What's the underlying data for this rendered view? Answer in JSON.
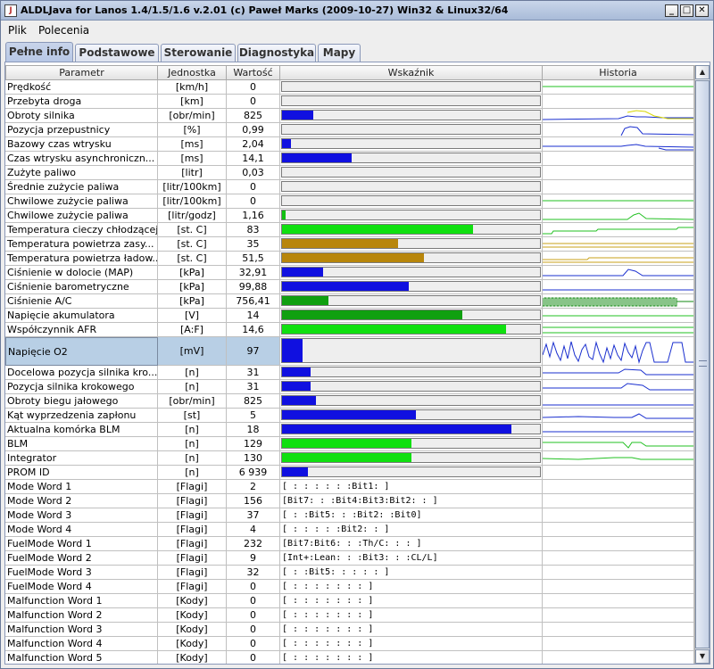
{
  "window": {
    "title": "ALDLJava for Lanos 1.4/1.5/1.6 v.2.01  (c) Paweł Marks (2009-10-27) Win32 & Linux32/64",
    "icon": "java-app-icon",
    "controls": [
      "minimize",
      "maximize",
      "close"
    ]
  },
  "menu": [
    "Plik",
    "Polecenia"
  ],
  "tabs": [
    {
      "label": "Pełne info",
      "active": true
    },
    {
      "label": "Podstawowe",
      "active": false
    },
    {
      "label": "Sterowanie",
      "active": false
    },
    {
      "label": "Diagnostyka",
      "active": false
    },
    {
      "label": "Mapy",
      "active": false
    }
  ],
  "table": {
    "headers": [
      "Parametr",
      "Jednostka",
      "Wartość",
      "Wskaźnik",
      "Historia"
    ],
    "rows": [
      {
        "param": "Prędkość",
        "unit": "[km/h]",
        "value": "0",
        "bar": 0,
        "color": "#1010e0",
        "hist": "flat-green"
      },
      {
        "param": "Przebyta droga",
        "unit": "[km]",
        "value": "0",
        "bar": 0,
        "color": "#1010e0",
        "hist": "none"
      },
      {
        "param": "Obroty silnika",
        "unit": "[obr/min]",
        "value": "825",
        "bar": 0.12,
        "color": "#1010e0",
        "hist": "rpm"
      },
      {
        "param": "Pozycja przepustnicy",
        "unit": "[%]",
        "value": "0,99",
        "bar": 0,
        "color": "#1010e0",
        "hist": "tps"
      },
      {
        "param": "Bazowy czas wtrysku",
        "unit": "[ms]",
        "value": "2,04",
        "bar": 0.035,
        "color": "#1010e0",
        "hist": "inj"
      },
      {
        "param": "Czas wtrysku asynchroniczn...",
        "unit": "[ms]",
        "value": "14,1",
        "bar": 0.27,
        "color": "#1010e0",
        "hist": "none"
      },
      {
        "param": "Zużyte paliwo",
        "unit": "[litr]",
        "value": "0,03",
        "bar": 0,
        "color": "#1010e0",
        "hist": "none"
      },
      {
        "param": "Średnie zużycie paliwa",
        "unit": "[litr/100km]",
        "value": "0",
        "bar": 0,
        "color": "#1010e0",
        "hist": "none"
      },
      {
        "param": "Chwilowe zużycie paliwa",
        "unit": "[litr/100km]",
        "value": "0",
        "bar": 0,
        "color": "#1010e0",
        "hist": "flat-green"
      },
      {
        "param": "Chwilowe zużycie paliwa",
        "unit": "[litr/godz]",
        "value": "1,16",
        "bar": 0.015,
        "color": "#10c010",
        "hist": "fuel-bump"
      },
      {
        "param": "Temperatura cieczy chłodzącej",
        "unit": "[st. C]",
        "value": "83",
        "bar": 0.74,
        "color": "#10e010",
        "hist": "coolant"
      },
      {
        "param": "Temperatura powietrza zasy...",
        "unit": "[st. C]",
        "value": "35",
        "bar": 0.45,
        "color": "#b8860b",
        "hist": "iat"
      },
      {
        "param": "Temperatura powietrza ładow...",
        "unit": "[st. C]",
        "value": "51,5",
        "bar": 0.55,
        "color": "#b8860b",
        "hist": "iat2"
      },
      {
        "param": "Ciśnienie w dolocie (MAP)",
        "unit": "[kPa]",
        "value": "32,91",
        "bar": 0.16,
        "color": "#1010e0",
        "hist": "map"
      },
      {
        "param": "Ciśnienie barometryczne",
        "unit": "[kPa]",
        "value": "99,88",
        "bar": 0.49,
        "color": "#1010e0",
        "hist": "baro"
      },
      {
        "param": "Ciśnienie A/C",
        "unit": "[kPa]",
        "value": "756,41",
        "bar": 0.18,
        "color": "#10a010",
        "hist": "ac"
      },
      {
        "param": "Napięcie akumulatora",
        "unit": "[V]",
        "value": "14",
        "bar": 0.7,
        "color": "#10a010",
        "hist": "batt"
      },
      {
        "param": "Współczynnik AFR",
        "unit": "[A:F]",
        "value": "14,6",
        "bar": 0.87,
        "color": "#10e010",
        "hist": "afr"
      },
      {
        "param": "Napięcie O2",
        "unit": "[mV]",
        "value": "97",
        "bar": 0.08,
        "color": "#1010e0",
        "hist": "o2",
        "big": true,
        "selected": true
      },
      {
        "param": "Docelowa pozycja silnika kro...",
        "unit": "[n]",
        "value": "31",
        "bar": 0.11,
        "color": "#1010e0",
        "hist": "iac1"
      },
      {
        "param": "Pozycja silnika krokowego",
        "unit": "[n]",
        "value": "31",
        "bar": 0.11,
        "color": "#1010e0",
        "hist": "iac2"
      },
      {
        "param": "Obroty biegu jałowego",
        "unit": "[obr/min]",
        "value": "825",
        "bar": 0.13,
        "color": "#1010e0",
        "hist": "idle"
      },
      {
        "param": "Kąt wyprzedzenia zapłonu",
        "unit": "[st]",
        "value": "5",
        "bar": 0.52,
        "color": "#1010e0",
        "hist": "spark"
      },
      {
        "param": "Aktualna komórka BLM",
        "unit": "[n]",
        "value": "18",
        "bar": 0.89,
        "color": "#1010e0",
        "hist": "blmcell"
      },
      {
        "param": "BLM",
        "unit": "[n]",
        "value": "129",
        "bar": 0.5,
        "color": "#10e010",
        "hist": "blm"
      },
      {
        "param": "Integrator",
        "unit": "[n]",
        "value": "130",
        "bar": 0.5,
        "color": "#10e010",
        "hist": "integ"
      },
      {
        "param": "PROM ID",
        "unit": "[n]",
        "value": "6 939",
        "bar": 0.1,
        "color": "#1010e0",
        "hist": "none"
      },
      {
        "param": "Mode Word 1",
        "unit": "[Flagi]",
        "value": "2",
        "text": "[   :    :    :    :    :    :Bit1:    ]"
      },
      {
        "param": "Mode Word 2",
        "unit": "[Flagi]",
        "value": "156",
        "text": "[Bit7:    :    :Bit4:Bit3:Bit2:    :    ]"
      },
      {
        "param": "Mode Word 3",
        "unit": "[Flagi]",
        "value": "37",
        "text": "[    :    :Bit5:    :    :Bit2:    :Bit0]"
      },
      {
        "param": "Mode Word 4",
        "unit": "[Flagi]",
        "value": "4",
        "text": "[    :    :    :    :    :Bit2:    :    ]"
      },
      {
        "param": "FuelMode Word 1",
        "unit": "[Flagi]",
        "value": "232",
        "text": "[Bit7:Bit6:    :    :Th/C:    :    :    ]"
      },
      {
        "param": "FuelMode Word 2",
        "unit": "[Flagi]",
        "value": "9",
        "text": "[Int+:Lean:    :    :Bit3:    :    :CL/L]"
      },
      {
        "param": "FuelMode Word 3",
        "unit": "[Flagi]",
        "value": "32",
        "text": "[    :    :Bit5:    :    :    :    :    ]"
      },
      {
        "param": "FuelMode Word 4",
        "unit": "[Flagi]",
        "value": "0",
        "text": "[    :    :    :    :    :    :    :    ]"
      },
      {
        "param": "Malfunction Word 1",
        "unit": "[Kody]",
        "value": "0",
        "text": "[  :  :  :  :  :  :  :  ]"
      },
      {
        "param": "Malfunction Word 2",
        "unit": "[Kody]",
        "value": "0",
        "text": "[  :  :  :  :  :  :  :  ]"
      },
      {
        "param": "Malfunction Word 3",
        "unit": "[Kody]",
        "value": "0",
        "text": "[  :  :  :  :  :  :  :  ]"
      },
      {
        "param": "Malfunction Word 4",
        "unit": "[Kody]",
        "value": "0",
        "text": "[  :  :  :  :  :  :  :  ]"
      },
      {
        "param": "Malfunction Word 5",
        "unit": "[Kody]",
        "value": "0",
        "text": "[  :  :  :  :  :  :  :  ]"
      }
    ]
  },
  "scrollbar": {
    "up_icon": "arrow-up-icon",
    "down_icon": "arrow-down-icon"
  }
}
